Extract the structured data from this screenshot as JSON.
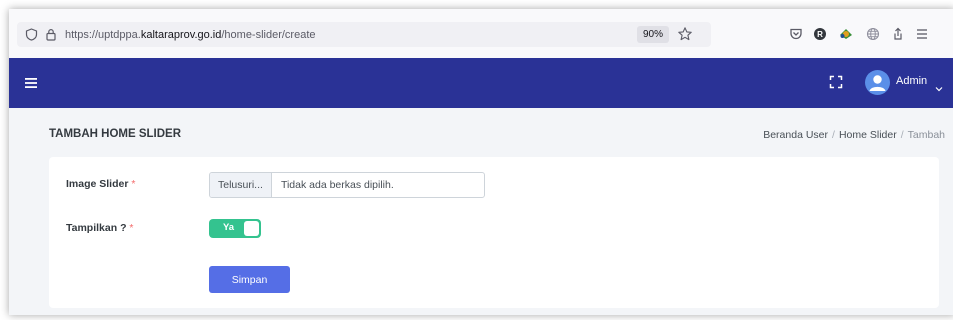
{
  "browser": {
    "url_prefix": "https://uptdppa.",
    "url_domain": "kaltaraprov.go.id",
    "url_path": "/home-slider/create",
    "zoom": "90%"
  },
  "topbar": {
    "user_label": "Admin"
  },
  "page": {
    "title": "TAMBAH HOME SLIDER",
    "breadcrumb": [
      "Beranda User",
      "Home Slider",
      "Tambah"
    ],
    "breadcrumb_sep": "/"
  },
  "form": {
    "image_label": "Image Slider",
    "required_mark": "*",
    "file_button": "Telusuri...",
    "file_status": "Tidak ada berkas dipilih.",
    "show_label": "Tampilkan ?",
    "toggle_text": "Ya",
    "submit_label": "Simpan"
  },
  "colors": {
    "navbar": "#2a3296",
    "toggle_on": "#34c38f",
    "primary": "#556ee6",
    "required": "#f46a6a"
  },
  "icons": [
    "shield-icon",
    "lock-icon",
    "star-icon",
    "pocket-icon",
    "extension-icon",
    "addon-icon",
    "globe-icon",
    "share-icon",
    "menu-icon",
    "fullscreen-icon",
    "user-icon",
    "chevron-down-icon"
  ]
}
